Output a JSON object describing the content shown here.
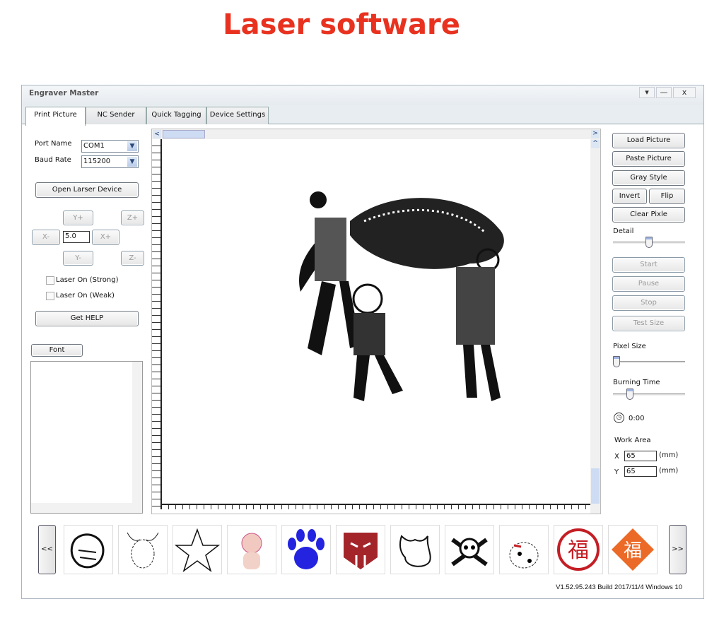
{
  "headline": "Laser software",
  "window": {
    "title": "Engraver Master",
    "controls": [
      "▾",
      "—",
      "x"
    ]
  },
  "tabs": [
    {
      "label": "Print Picture",
      "active": true
    },
    {
      "label": "NC Sender"
    },
    {
      "label": "Quick Tagging"
    },
    {
      "label": "Device Settings"
    }
  ],
  "left": {
    "port_label": "Port Name",
    "port_value": "COM1",
    "baud_label": "Baud Rate",
    "baud_value": "115200",
    "open_btn": "Open Larser Device",
    "jog": {
      "yplus": "Y+",
      "yminus": "Y-",
      "xplus": "X+",
      "xminus": "X-",
      "zplus": "Z+",
      "zminus": "Z-",
      "step": "5.0"
    },
    "laser_strong": "Laser On (Strong)",
    "laser_weak": "Laser On (Weak)",
    "help_btn": "Get HELP",
    "font_btn": "Font",
    "text_value": ""
  },
  "right": {
    "load": "Load Picture",
    "paste": "Paste Picture",
    "gray": "Gray Style",
    "invert": "Invert",
    "flip": "Flip",
    "clear": "Clear Pixle",
    "detail_label": "Detail",
    "detail_value": 0.5,
    "start": "Start",
    "pause": "Pause",
    "stop": "Stop",
    "test": "Test Size",
    "pixel_label": "Pixel Size",
    "pixel_value": 0,
    "burn_label": "Burning Time",
    "burn_value": 0.2,
    "time": "0:00",
    "work_label": "Work Area",
    "x_label": "X",
    "x_value": "65",
    "y_label": "Y",
    "y_value": "65",
    "unit": "(mm)"
  },
  "gallery": {
    "prev": "<<",
    "next": ">>",
    "items": [
      "pointing-hand",
      "bull",
      "star",
      "anime-girl",
      "paw-print",
      "autobot-logo",
      "cow",
      "skull-crossbones",
      "dalmatian",
      "fu-seal",
      "fu-diamond"
    ],
    "fu_char": "福"
  },
  "colors": {
    "paw": "#2323e0",
    "autobot": "#a3252a",
    "fu_red": "#c41e25",
    "fu_orange": "#ec6a27",
    "headline": "#e8321f"
  },
  "status": "V1.52.95.243 Build 2017/11/4 Windows 10"
}
